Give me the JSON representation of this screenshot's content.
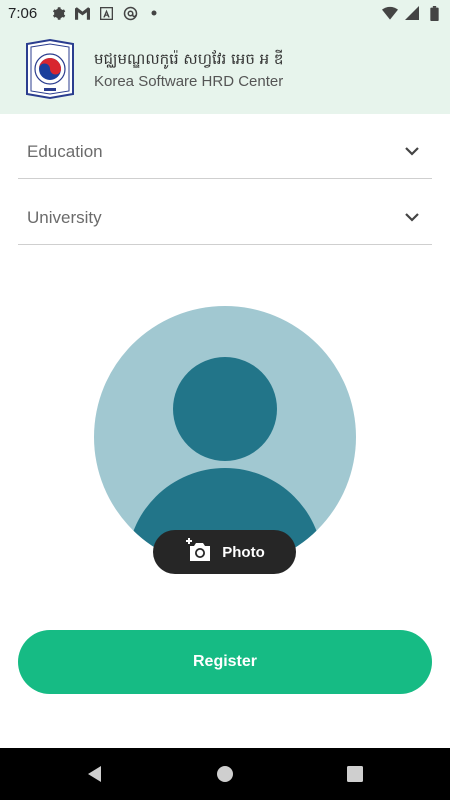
{
  "status_bar": {
    "time": "7:06",
    "left_icons": [
      "gear-icon",
      "gmail-icon",
      "a-icon",
      "at-sync-icon",
      "dot-icon"
    ],
    "right_icons": [
      "wifi-icon",
      "signal-icon",
      "battery-icon"
    ]
  },
  "header": {
    "title_km": "មជ្ឈមណ្ឌលកូរ៉េ សហ្វវែរ អេច អ ឌី",
    "title_en": "Korea Software HRD Center",
    "logo": "korea-hrd-logo"
  },
  "form": {
    "education_label": "Education",
    "university_label": "University",
    "photo_label": "Photo",
    "register_label": "Register"
  },
  "colors": {
    "header_bg": "#e7f4ec",
    "accent": "#16bb84",
    "avatar_bg": "#a1c8d1",
    "avatar_fg": "#227589"
  }
}
